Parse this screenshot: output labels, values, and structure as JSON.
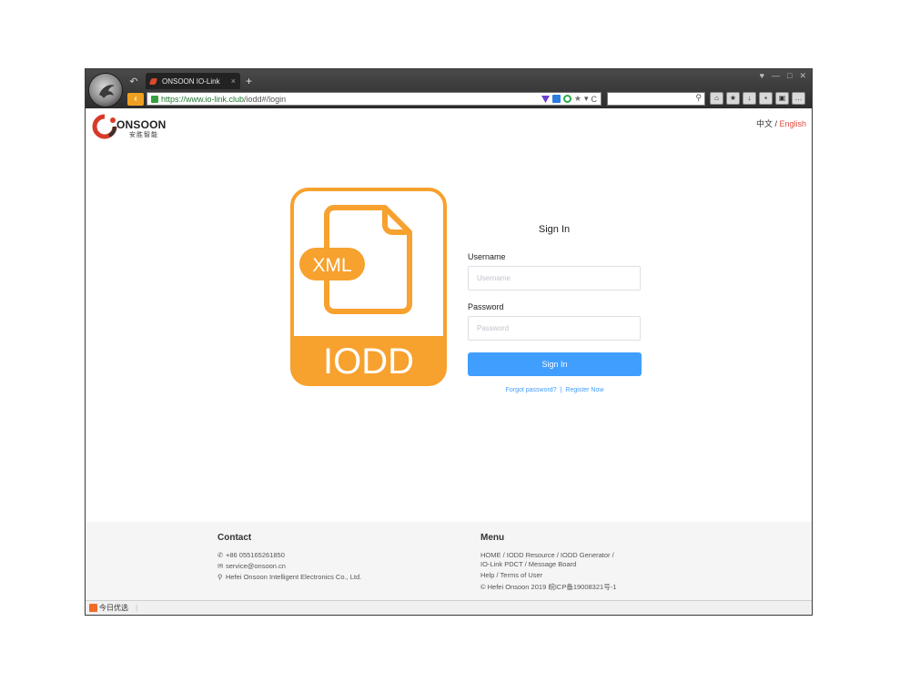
{
  "browser": {
    "tab_title": "ONSOON IO-Link",
    "tab_close": "×",
    "new_tab": "+",
    "back_arrow": "↶",
    "nav_back": "‹",
    "url_scheme": "https://",
    "url_host": "www.io-link.club",
    "url_path": "/iodd#/login",
    "addr_star": "★",
    "addr_dropdown": "▾",
    "addr_reload": "C",
    "window_controls": [
      "♥",
      "—",
      "□",
      "✕"
    ]
  },
  "header": {
    "logo_name": "ONSOON",
    "logo_subtitle": "安胜智能",
    "lang_zh": "中文",
    "lang_sep": " / ",
    "lang_en": "English"
  },
  "illustration": {
    "xml_label": "XML",
    "iodd_label": "IODD",
    "accent": "#f7a12e"
  },
  "signin": {
    "title": "Sign In",
    "username_label": "Username",
    "username_placeholder": "Username",
    "password_label": "Password",
    "password_placeholder": "Password",
    "button": "Sign In",
    "forgot": "Forgot password?",
    "link_sep": "|",
    "register": "Register Now",
    "button_color": "#409eff"
  },
  "footer": {
    "contact_title": "Contact",
    "phone": "+86 055165261850",
    "email": "service@onsoon.cn",
    "address": "Hefei Onsoon Intelligent Electronics Co., Ltd.",
    "menu_title": "Menu",
    "menu_line1": "HOME  /  IODD Resource  /  IODD Generator  /",
    "menu_line2": "IO-Link PDCT  /  Message Board",
    "menu_line3": "Help  /  Terms of User",
    "copyright": "© Hefei Onsoon 2019   皖ICP备19008321号-1"
  },
  "statusbar": {
    "item": "今日优选"
  }
}
